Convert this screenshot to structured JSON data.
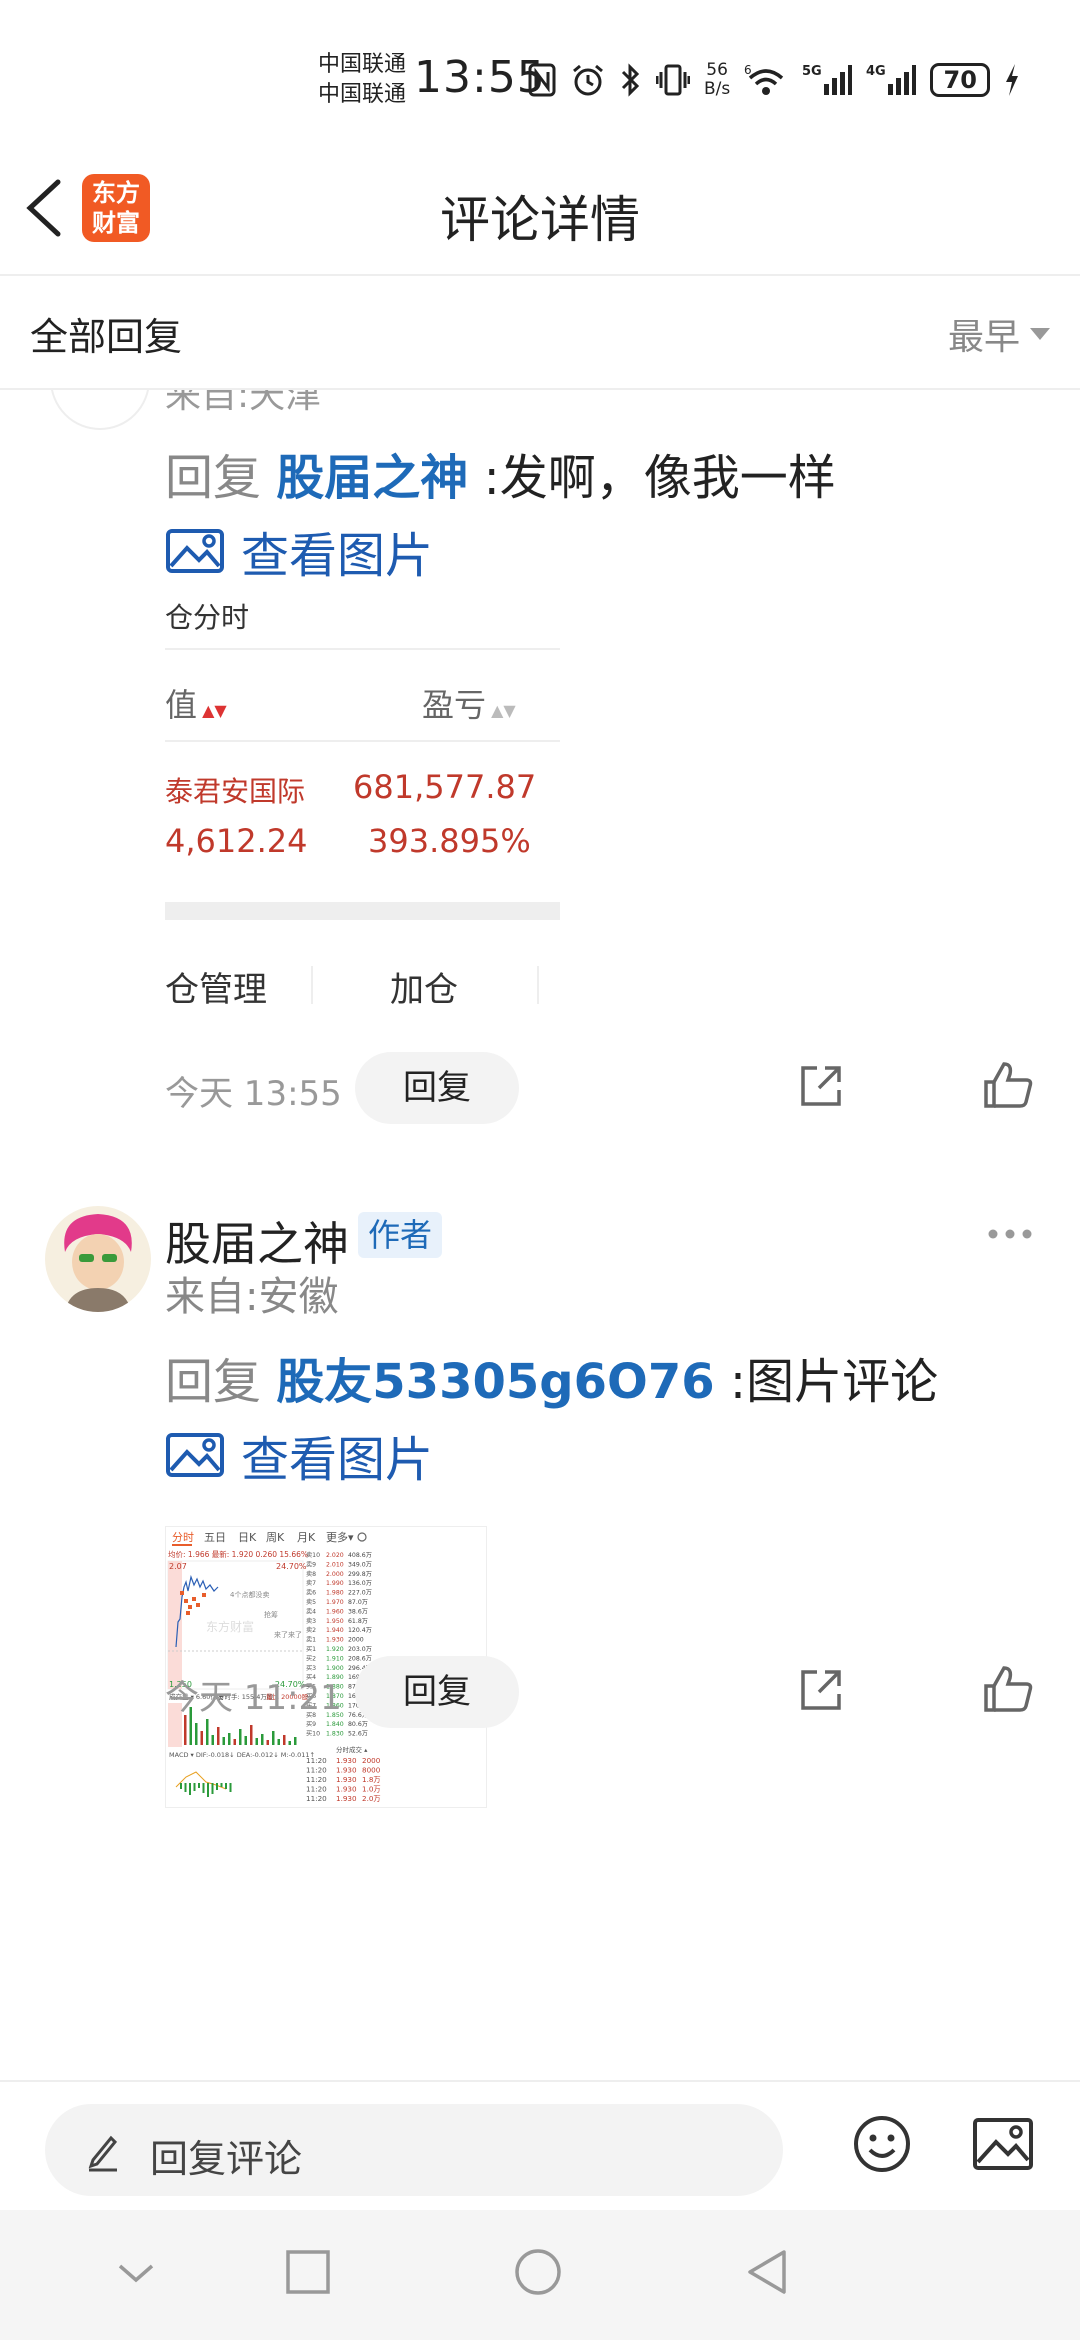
{
  "status_bar": {
    "carrier_1": "中国联通",
    "carrier_2": "中国联通",
    "time": "13:55",
    "net_speed_value": "56",
    "net_speed_unit": "B/s",
    "signal_1": "5G",
    "signal_2": "4G",
    "wifi_tag": "6",
    "battery": "70"
  },
  "header": {
    "logo_line1": "东方",
    "logo_line2": "财富",
    "title": "评论详情"
  },
  "filter": {
    "all_replies": "全部回复",
    "sort": "最早"
  },
  "comment1": {
    "location_partial": "来自:天津",
    "reply_keyword": "回复",
    "reply_to": "股届之神",
    "text": ":发啊，像我一样",
    "view_image": "查看图片",
    "image": {
      "heading": "仓分时",
      "col_value": "值",
      "col_pl": "盈亏",
      "row1_name": "泰君安国际",
      "row1_value": "681,577.87",
      "row2_value": "4,612.24",
      "row2_pct": "393.895%",
      "btn_manage": "仓管理",
      "btn_add": "加仓"
    },
    "time": "今天 13:55",
    "reply_button": "回复"
  },
  "comment2": {
    "username": "股届之神",
    "author_badge": "作者",
    "location": "来自:安徽",
    "reply_keyword": "回复",
    "reply_to": "股友53305g6O76",
    "text": ":图片评论",
    "view_image": "查看图片",
    "image": {
      "tabs": [
        "分时",
        "五日",
        "日K",
        "周K",
        "月K",
        "更多▾"
      ],
      "avg_line": "均价: 1.966  最新: 1.920  0.260  15.66%",
      "top_price": "2.07",
      "top_pct": "24.70%",
      "bottom_price": "1.250",
      "bottom_pct": "-24.70%",
      "volume_label": "成交量 ▾ 6.60亿股",
      "volume_note": "分时手: 155.4万股",
      "volume_note2": "量比 20000股",
      "macd": "MACD ▾ DIF:-0.018↓ DEA:-0.012↓ M:-0.011↑",
      "bubble1": "4个点都没卖",
      "bubble2": "抢筹",
      "bubble3": "来了来了",
      "order_book": [
        {
          "label": "卖10",
          "price": "2.020",
          "vol": "408.6万"
        },
        {
          "label": "卖9",
          "price": "2.010",
          "vol": "349.0万"
        },
        {
          "label": "卖8",
          "price": "2.000",
          "vol": "299.8万"
        },
        {
          "label": "卖7",
          "price": "1.990",
          "vol": "136.0万"
        },
        {
          "label": "卖6",
          "price": "1.980",
          "vol": "227.0万"
        },
        {
          "label": "卖5",
          "price": "1.970",
          "vol": "87.0万"
        },
        {
          "label": "卖4",
          "price": "1.960",
          "vol": "38.6万"
        },
        {
          "label": "卖3",
          "price": "1.950",
          "vol": "61.8万"
        },
        {
          "label": "卖2",
          "price": "1.940",
          "vol": "120.4万"
        },
        {
          "label": "卖1",
          "price": "1.930",
          "vol": "2000"
        },
        {
          "label": "买1",
          "price": "1.920",
          "vol": "203.0万"
        },
        {
          "label": "买2",
          "price": "1.910",
          "vol": "208.6万"
        },
        {
          "label": "买3",
          "price": "1.900",
          "vol": "296.4万"
        },
        {
          "label": "买4",
          "price": "1.890",
          "vol": "169.6万"
        },
        {
          "label": "买5",
          "price": "1.880",
          "vol": "870.8万"
        },
        {
          "label": "买6",
          "price": "1.870",
          "vol": "160.4万"
        },
        {
          "label": "买7",
          "price": "1.860",
          "vol": "170.8万"
        },
        {
          "label": "买8",
          "price": "1.850",
          "vol": "76.6万"
        },
        {
          "label": "买9",
          "price": "1.840",
          "vol": "80.6万"
        },
        {
          "label": "买10",
          "price": "1.830",
          "vol": "52.6万"
        }
      ],
      "trades_title": "分时成交 ▴",
      "trades": [
        {
          "t": "11:20",
          "p": "1.930",
          "v": "2000"
        },
        {
          "t": "11:20",
          "p": "1.930",
          "v": "8000"
        },
        {
          "t": "11:20",
          "p": "1.930",
          "v": "1.8万"
        },
        {
          "t": "11:20",
          "p": "1.930",
          "v": "1.0万"
        },
        {
          "t": "11:20",
          "p": "1.930",
          "v": "2.0万"
        }
      ],
      "watermark": "东方财富"
    },
    "time": "今天 11:21",
    "reply_button": "回复"
  },
  "bottom_bar": {
    "placeholder": "回复评论"
  },
  "colors": {
    "link_blue": "#1e6ab8",
    "logo_orange": "#f15a24",
    "loss_red": "#c0392b"
  },
  "icons": [
    "back-arrow-icon",
    "image-icon",
    "share-icon",
    "like-icon",
    "more-icon",
    "pencil-icon",
    "emoji-icon",
    "picture-icon"
  ]
}
